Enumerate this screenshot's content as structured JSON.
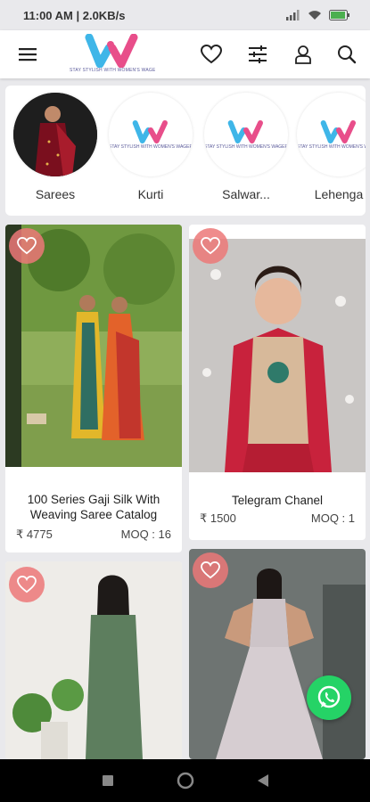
{
  "status_bar": {
    "time_info": "11:00 AM | 2.0KB/s"
  },
  "header": {
    "logo_tagline": "STAY STYLISH WITH WOMEN'S WAGER",
    "icons": [
      "menu-icon",
      "heart-icon",
      "filter-icon",
      "user-icon",
      "search-icon"
    ]
  },
  "categories": [
    {
      "label": "Sarees"
    },
    {
      "label": "Kurti"
    },
    {
      "label": "Salwar..."
    },
    {
      "label": "Lehenga"
    }
  ],
  "products": [
    {
      "name": "100 Series Gaji Silk With Weaving Saree Catalog",
      "price": "₹ 4775",
      "moq": "MOQ : 16"
    },
    {
      "name": "Telegram Chanel",
      "price": "₹ 1500",
      "moq": "MOQ : 1"
    },
    {
      "name": "",
      "price": "",
      "moq": ""
    },
    {
      "name": "",
      "price": "",
      "moq": ""
    }
  ],
  "colors": {
    "brand_pink": "#e84e8a",
    "brand_blue": "#3fb6e8",
    "heart_badge": "#ec7878",
    "whatsapp": "#25D366"
  }
}
